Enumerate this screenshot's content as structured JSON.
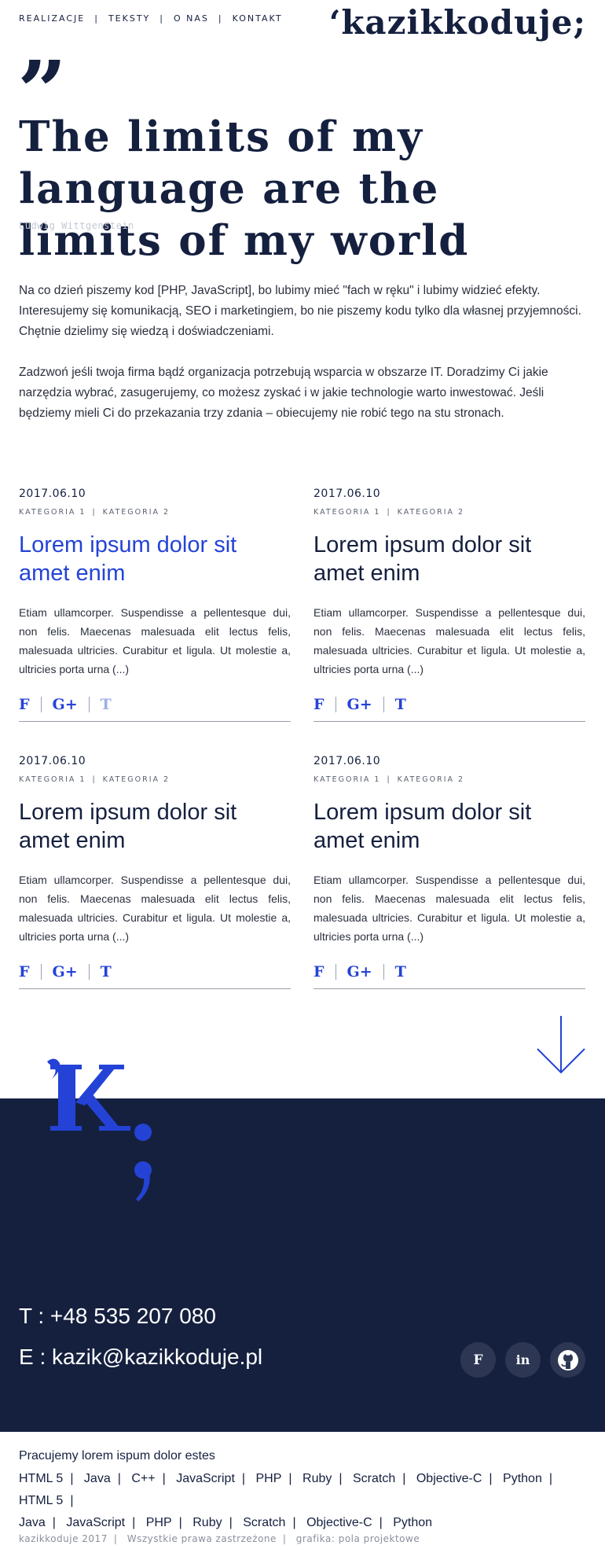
{
  "nav": {
    "items": [
      "REALIZACJE",
      "TEKSTY",
      "O NAS",
      "KONTAKT"
    ],
    "logo": "‘kazikkoduje;"
  },
  "hero": {
    "quote_mark": "”",
    "title": "The limits of my language are the limits of my world",
    "author": "Ludwig Wittgenstein"
  },
  "intro": {
    "p1": "Na co dzień piszemy kod [PHP, JavaScript], bo lubimy mieć \"fach w ręku\" i lubimy widzieć efekty. Interesujemy się komunikacją, SEO i marketingiem, bo nie piszemy kodu tylko dla własnej przyjemności. Chętnie dzielimy się wiedzą i doświadczeniami.",
    "p2": "Zadzwoń jeśli twoja firma bądź organizacja potrzebują wsparcia w obszarze IT. Doradzimy Ci jakie narzędzia wybrać, zasugerujemy, co możesz zyskać i w jakie technologie warto inwestować. Jeśli będziemy mieli Ci do przekazania trzy zdania – obiecujemy nie robić tego na stu stronach."
  },
  "posts": [
    {
      "date": "2017.06.10",
      "cat1": "KATEGORIA 1",
      "cat2": "KATEGORIA 2",
      "title": "Lorem ipsum dolor sit amet enim",
      "excerpt": "Etiam ullamcorper. Suspendisse a pellentesque dui, non felis. Maecenas malesuada elit lectus felis, malesuada ultricies. Curabitur et ligula. Ut molestie a, ultricies porta urna (...)",
      "share": [
        "F",
        "G+",
        "T"
      ]
    },
    {
      "date": "2017.06.10",
      "cat1": "KATEGORIA 1",
      "cat2": "KATEGORIA 2",
      "title": "Lorem ipsum dolor sit amet enim",
      "excerpt": "Etiam ullamcorper. Suspendisse a pellentesque dui, non felis. Maecenas malesuada elit lectus felis, malesuada ultricies. Curabitur et ligula. Ut molestie a, ultricies porta urna (...)",
      "share": [
        "F",
        "G+",
        "T"
      ]
    },
    {
      "date": "2017.06.10",
      "cat1": "KATEGORIA 1",
      "cat2": "KATEGORIA 2",
      "title": "Lorem ipsum dolor sit amet enim",
      "excerpt": "Etiam ullamcorper. Suspendisse a pellentesque dui, non felis. Maecenas malesuada elit lectus felis, malesuada ultricies. Curabitur et ligula. Ut molestie a, ultricies porta urna (...)",
      "share": [
        "F",
        "G+",
        "T"
      ]
    },
    {
      "date": "2017.06.10",
      "cat1": "KATEGORIA 1",
      "cat2": "KATEGORIA 2",
      "title": "Lorem ipsum dolor sit amet enim",
      "excerpt": "Etiam ullamcorper. Suspendisse a pellentesque dui, non felis. Maecenas malesuada elit lectus felis, malesuada ultricies. Curabitur et ligula. Ut molestie a, ultricies porta urna (...)",
      "share": [
        "F",
        "G+",
        "T"
      ]
    }
  ],
  "contact": {
    "phone": "T : +48 535 207 080",
    "email": "E : kazik@kazikkoduje.pl",
    "social_icons": [
      "facebook-icon",
      "linkedin-icon",
      "github-icon"
    ],
    "facebook_glyph": "F",
    "linkedin_glyph": "in"
  },
  "tech": {
    "heading": "Pracujemy lorem ispum dolor estes",
    "row1": [
      "HTML 5",
      "Java",
      "C++",
      "JavaScript",
      "PHP",
      "Ruby",
      "Scratch",
      "Objective-C",
      "Python",
      "HTML 5"
    ],
    "row2": [
      "Java",
      "JavaScript",
      "PHP",
      "Ruby",
      "Scratch",
      "Objective-C",
      "Python"
    ]
  },
  "footer": {
    "brand": "kazikkoduje 2017",
    "rights": "Wszystkie prawa zastrzeżone",
    "credit": "grafika: pola projektowe"
  },
  "colors": {
    "navy": "#15203f",
    "accent_blue": "#2443d6",
    "gray_text": "#8a8f9c"
  }
}
